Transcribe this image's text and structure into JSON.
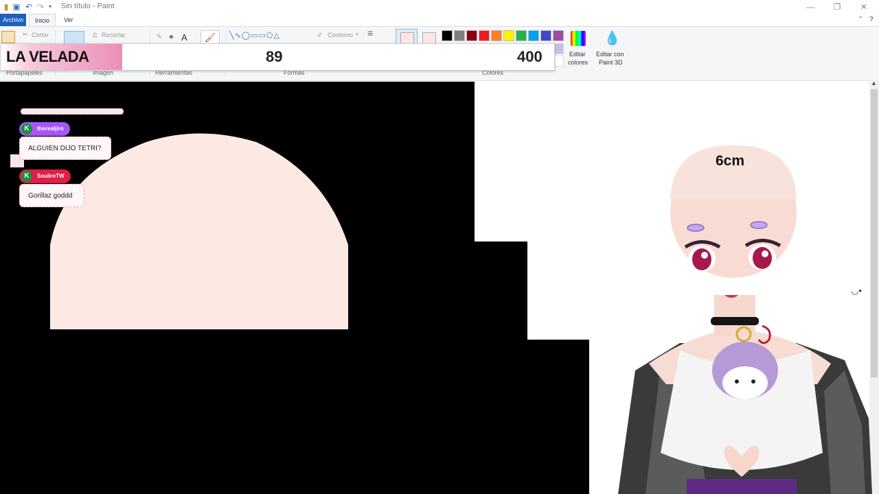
{
  "window": {
    "title": "Sin título - Paint"
  },
  "tabs": {
    "file": "Archivo",
    "home": "Inicio",
    "view": "Ver"
  },
  "ribbon": {
    "cut_label": "Cortar",
    "crop_label": "Recortar",
    "outline_label": "Contorno",
    "edit_colors_line1": "Editar",
    "edit_colors_line2": "colores",
    "edit_3d_line1": "Editar con",
    "edit_3d_line2": "Paint 3D",
    "groups": {
      "clipboard": "Portapapeles",
      "image": "Imagen",
      "tools": "Herramientas",
      "shapes": "Formas",
      "colors": "Colores"
    },
    "palette": [
      "#000000",
      "#7f7f7f",
      "#880015",
      "#ed1c24",
      "#ff7f27",
      "#fff200",
      "#22b14c",
      "#00a2e8",
      "#3f48cc",
      "#a349a4"
    ]
  },
  "scoreboard": {
    "title": "LA VELADA",
    "score_a": "89",
    "score_b": "400",
    "accent": "#ea8fb6"
  },
  "chat": {
    "messages": [
      {
        "user": "therealjiro",
        "text": "ALGUIEN DIJO TETRI?",
        "color": "#a855f7"
      },
      {
        "user": "SoulireTW",
        "text": "Gorillaz goddd",
        "color": "#e11d48"
      }
    ]
  },
  "avatar": {
    "size_label": "6cm"
  }
}
